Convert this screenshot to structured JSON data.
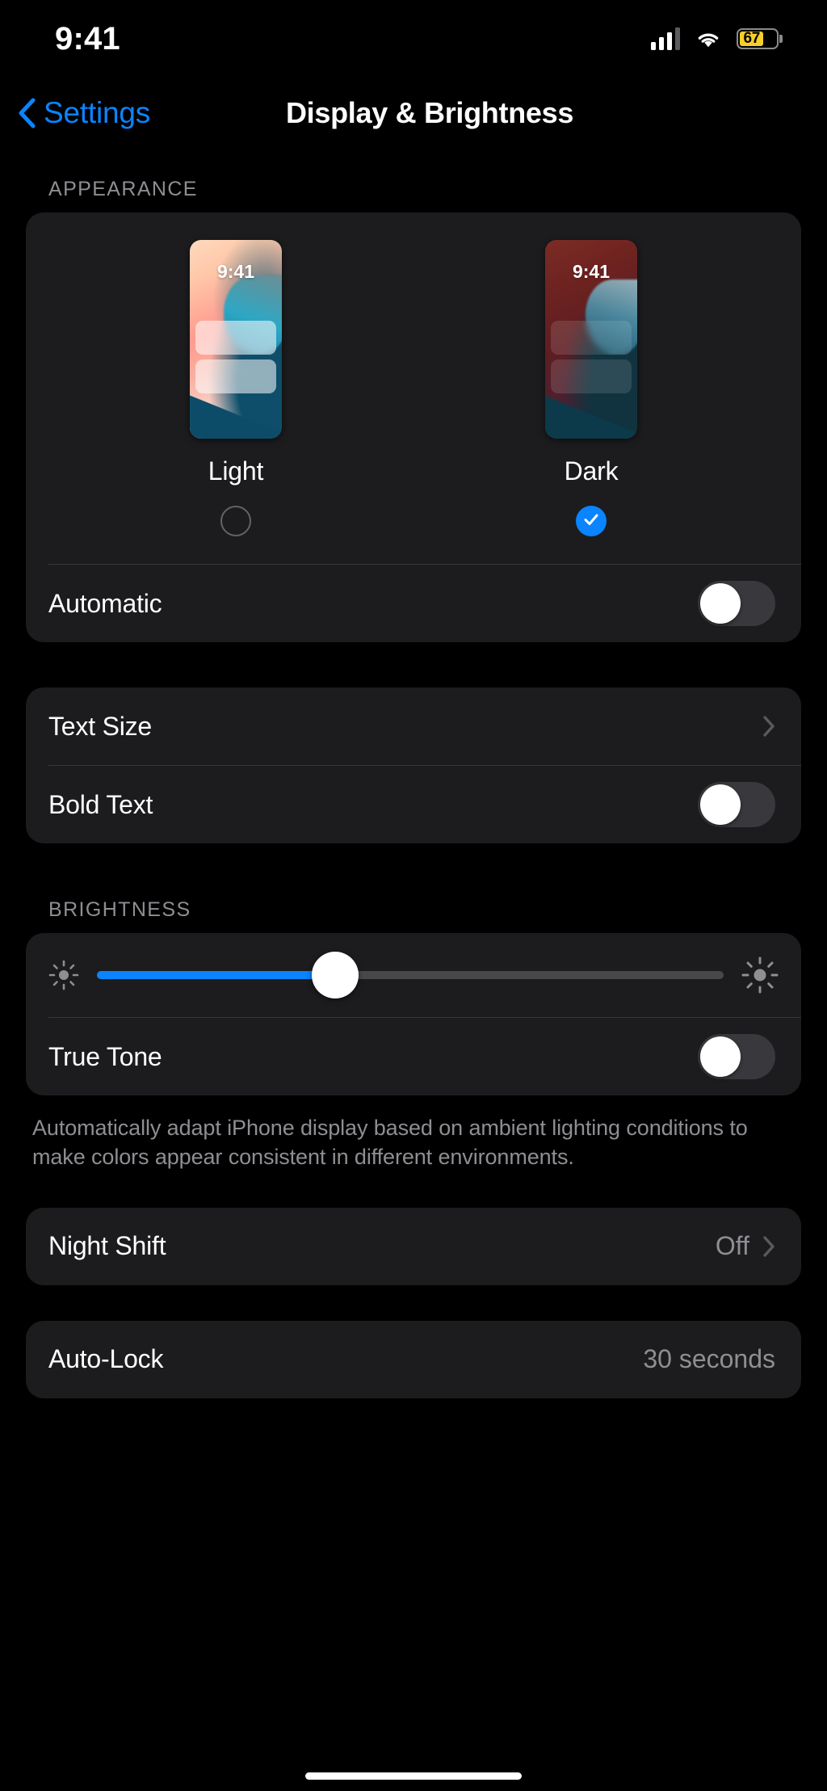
{
  "status_bar": {
    "time": "9:41",
    "battery_percent": "67",
    "battery_level": 67,
    "battery_color": "#f7cf28",
    "cellular_icon": "cellular-bars-icon",
    "wifi_icon": "wifi-icon",
    "battery_icon": "battery-icon"
  },
  "nav": {
    "back_label": "Settings",
    "back_icon": "chevron-left-icon",
    "title": "Display & Brightness",
    "accent_color": "#0a84ff"
  },
  "appearance": {
    "header": "APPEARANCE",
    "options": [
      {
        "label": "Light",
        "preview_time": "9:41",
        "selected": false
      },
      {
        "label": "Dark",
        "preview_time": "9:41",
        "selected": true
      }
    ],
    "automatic": {
      "label": "Automatic",
      "state": "off"
    }
  },
  "text_group": {
    "text_size": {
      "label": "Text Size",
      "chevron_icon": "chevron-right-icon"
    },
    "bold_text": {
      "label": "Bold Text",
      "state": "off"
    }
  },
  "brightness": {
    "header": "BRIGHTNESS",
    "slider": {
      "value_percent": 38,
      "min_icon": "sun-low-icon",
      "max_icon": "sun-high-icon",
      "fill_color": "#0a84ff"
    },
    "true_tone": {
      "label": "True Tone",
      "state": "off"
    },
    "footer": "Automatically adapt iPhone display based on ambient lighting conditions to make colors appear consistent in different environments."
  },
  "night_shift": {
    "label": "Night Shift",
    "value": "Off",
    "chevron_icon": "chevron-right-icon"
  },
  "auto_lock": {
    "label": "Auto-Lock",
    "value": "30 seconds"
  }
}
